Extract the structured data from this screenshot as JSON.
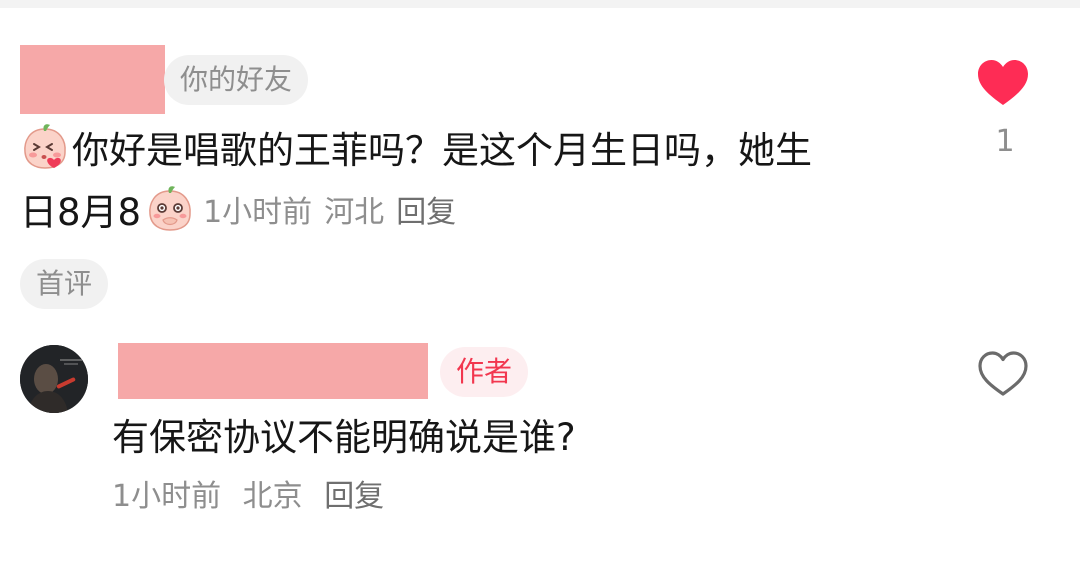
{
  "colors": {
    "accent_red": "#fe2c55",
    "author_tag_text": "#f2374f",
    "redaction": "#f6a8a8",
    "meta_gray": "#8e8e8e"
  },
  "comment": {
    "relation_tag": "你的好友",
    "emoji_leading": "blush-peach-emoji",
    "text_part1": "你好是唱歌的王菲吗？是这个月生日吗，她生",
    "text_part2": "日8月8",
    "emoji_trailing": "giggle-peach-emoji",
    "time": "1小时前",
    "location": "河北",
    "reply_label": "回复",
    "like_icon": "heart-filled-icon",
    "like_count": "1",
    "first_comment_tag": "首评"
  },
  "reply": {
    "author_tag": "作者",
    "text": "有保密协议不能明确说是谁?",
    "time": "1小时前",
    "location": "北京",
    "reply_label": "回复",
    "like_icon": "heart-outline-icon"
  }
}
